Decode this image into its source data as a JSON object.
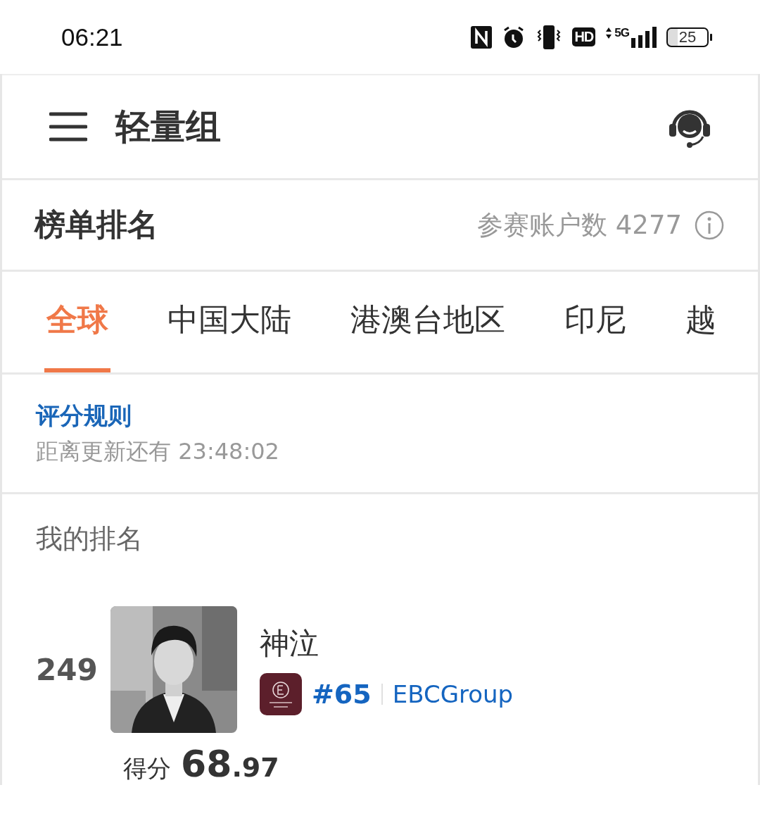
{
  "status_bar": {
    "time": "06:21",
    "hd": "HD",
    "network": "5G",
    "battery": "25"
  },
  "header": {
    "title": "轻量组"
  },
  "ranking_header": {
    "title": "榜单排名",
    "participants_label": "参赛账户数 4277"
  },
  "tabs": [
    {
      "label": "全球",
      "selected": true
    },
    {
      "label": "中国大陆",
      "selected": false
    },
    {
      "label": "港澳台地区",
      "selected": false
    },
    {
      "label": "印尼",
      "selected": false
    },
    {
      "label": "越",
      "selected": false
    }
  ],
  "rules": {
    "link": "评分规则",
    "countdown": "距离更新还有 23:48:02"
  },
  "my_ranking": {
    "title": "我的排名",
    "rank": "249",
    "name": "神泣",
    "team_rank": "#65",
    "team": "EBCGroup",
    "score_label": "得分",
    "score": "68.97"
  }
}
